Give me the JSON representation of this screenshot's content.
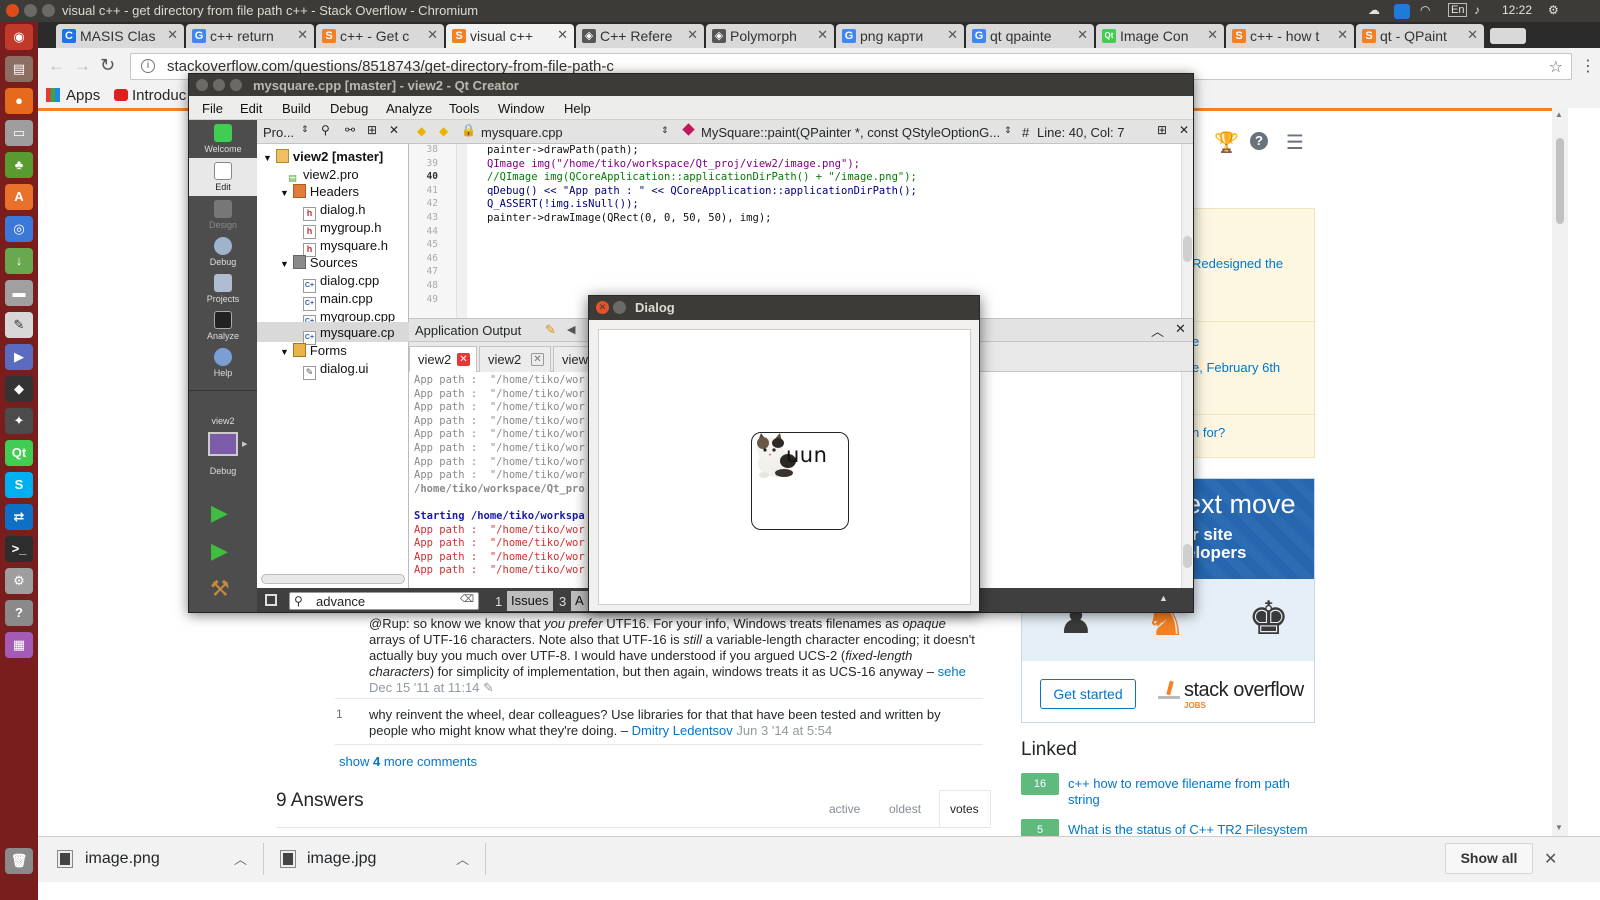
{
  "topbar": {
    "window_title": "visual c++ - get directory from file path c++ - Stack Overflow - Chromium",
    "keyboard_layout": "En",
    "clock": "12:22"
  },
  "launcher": {
    "items": [
      "dash-icon",
      "files-icon",
      "firefox-icon",
      "disk-icon",
      "android-icon",
      "software-center-icon",
      "chromium-icon",
      "download-icon",
      "drive-icon",
      "editor-icon",
      "media-icon",
      "inkscape-icon",
      "gimp-icon",
      "qt-creator-icon",
      "skype-icon",
      "teamviewer-icon",
      "terminal-icon",
      "settings-icon",
      "help-icon",
      "workspace-icon",
      "trash-icon"
    ]
  },
  "browser": {
    "tabs": [
      {
        "label": "MASIS Clas",
        "favicon": "C",
        "color": "#1a73e8"
      },
      {
        "label": "c++ return",
        "favicon": "G",
        "color": "#4285f4"
      },
      {
        "label": "c++ - Get c",
        "favicon": "S",
        "color": "#f48024"
      },
      {
        "label": "visual c++",
        "favicon": "S",
        "color": "#f48024"
      },
      {
        "label": "C++ Refere",
        "favicon": "◈",
        "color": "#555555"
      },
      {
        "label": "Polymorph",
        "favicon": "◈",
        "color": "#555555"
      },
      {
        "label": "png карти",
        "favicon": "G",
        "color": "#4285f4"
      },
      {
        "label": "qt qpainte",
        "favicon": "G",
        "color": "#4285f4"
      },
      {
        "label": "Image Con",
        "favicon": "Qt",
        "color": "#41cd52"
      },
      {
        "label": "c++ - how t",
        "favicon": "S",
        "color": "#f48024"
      },
      {
        "label": "qt - QPaint",
        "favicon": "S",
        "color": "#f48024"
      }
    ],
    "active_tab_index": 3,
    "url": "stackoverflow.com/questions/8518743/get-directory-from-file-path-c",
    "bookmarks": {
      "apps": "Apps",
      "intro": "Introduc"
    }
  },
  "stackoverflow": {
    "comment1": {
      "text_1": "@Rup: so know we know that ",
      "em_1": "you prefer",
      "text_2": " UTF16. For your info, Windows treats filenames as ",
      "em_2": "opaque",
      "text_3": " arrays of UTF-16 characters. Note also that UTF-16 is ",
      "em_3": "still",
      "text_4": " a variable-length character encoding; it doesn't actually buy you much over UTF-8. I would have understood if you argued UCS-2 (",
      "em_4": "fixed-length characters",
      "text_5": ") for simplicity of implementation, but then again, windows treats it as UCS-16 anyway – ",
      "user": "sehe",
      "date": "Dec 15 '11 at 11:14"
    },
    "comment2": {
      "score": "1",
      "text": "why reinvent the wheel, dear colleagues? Use libraries for that that have been tested and written by people who might know what they're doing. – ",
      "user": "Dmitry Ledentsov",
      "date": "Jun 3 '14 at 5:54"
    },
    "show_more": {
      "prefix": "show ",
      "count": "4",
      "suffix": " more comments"
    },
    "answers_heading": "9 Answers",
    "sort_tabs": [
      "active",
      "oldest",
      "votes"
    ],
    "sidebar": {
      "meta_fragments": [
        "Redesigned the",
        "e",
        "e, February 6th",
        "n for?"
      ],
      "ad_line1": "ext move",
      "ad_line2": "r site",
      "ad_line3": "elopers",
      "ad_button": "Get started",
      "ad_brand": "stack overflow",
      "ad_brand_sub": "JOBS",
      "linked_heading": "Linked",
      "linked": [
        {
          "score": "16",
          "title": "c++ how to remove filename from path string"
        },
        {
          "score": "5",
          "title": "What is the status of C++ TR2 Filesystem"
        }
      ]
    }
  },
  "downloads": {
    "items": [
      "image.png",
      "image.jpg"
    ],
    "show_all": "Show all"
  },
  "qtcreator": {
    "title": "mysquare.cpp [master] - view2 - Qt Creator",
    "menu": [
      "File",
      "Edit",
      "Build",
      "Debug",
      "Analyze",
      "Tools",
      "Window",
      "Help"
    ],
    "modes": [
      "Welcome",
      "Edit",
      "Design",
      "Debug",
      "Projects",
      "Analyze",
      "Help"
    ],
    "kit_label": "view2",
    "kit_mode": "Debug",
    "project_header": "Pro...",
    "tree": {
      "root": "view2 [master]",
      "pro": "view2.pro",
      "headers": "Headers",
      "header_files": [
        "dialog.h",
        "mygroup.h",
        "mysquare.h"
      ],
      "sources": "Sources",
      "source_files": [
        "dialog.cpp",
        "main.cpp",
        "mygroup.cpp",
        "mysquare.cp"
      ],
      "forms": "Forms",
      "form_files": [
        "dialog.ui"
      ]
    },
    "editor": {
      "file": "mysquare.cpp",
      "symbol": "MySquare::paint(QPainter *, const QStyleOptionG...",
      "position": "Line: 40, Col: 7",
      "line_numbers": [
        "38",
        "39",
        "40",
        "41",
        "42",
        "43",
        "44",
        "45",
        "46",
        "47",
        "48",
        "49"
      ],
      "code": [
        "painter->drawPath(path);",
        "QImage img(\"/home/tiko/workspace/Qt_proj/view2/image.png\");",
        "//QImage img(QCoreApplication::applicationDirPath() + \"/image.png\");",
        "qDebug() << \"App path : \" << QCoreApplication::applicationDirPath();",
        "Q_ASSERT(!img.isNull());",
        "painter->drawImage(QRect(0, 0, 50, 50), img);"
      ]
    },
    "output": {
      "title": "Application Output",
      "tabs": [
        "view2",
        "view2",
        "view"
      ],
      "gray_line": "App path :  \"/home/tiko/wor",
      "exited_line": "/home/tiko/workspace/Qt_pro",
      "starting_line": "Starting /home/tiko/workspa",
      "red_line": "App path :  \"/home/tiko/wor"
    },
    "status": {
      "search_value": "advance",
      "issues_num": "1",
      "issues_label": "Issues",
      "next_num": "3",
      "next_label": "A"
    }
  },
  "dialog": {
    "title": "Dialog",
    "square_text": "uun"
  }
}
